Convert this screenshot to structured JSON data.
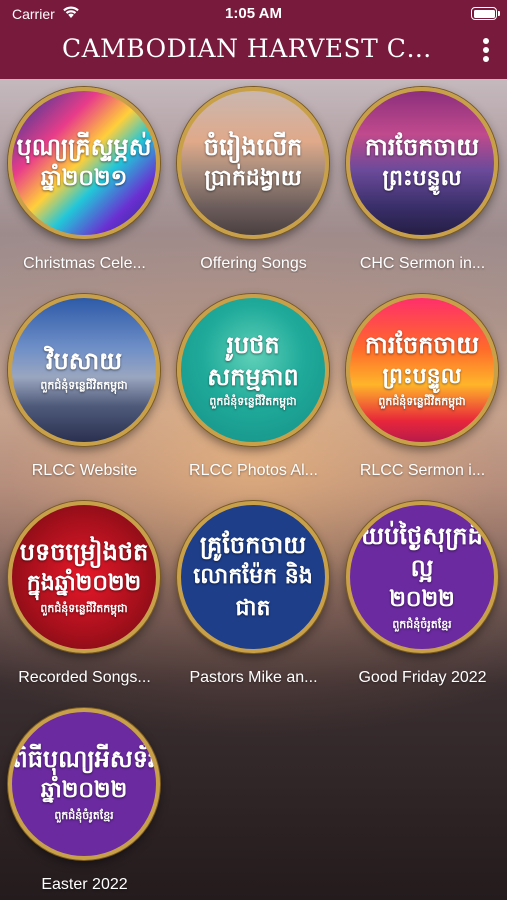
{
  "status_bar": {
    "carrier": "Carrier",
    "time": "1:05 AM"
  },
  "header": {
    "title": "CAMBODIAN HARVEST CH..."
  },
  "tiles": [
    {
      "label": "Christmas Cele...",
      "art_line1": "បុណ្យគ្រីស្ទម្ភស់",
      "art_line2": "ឆ្នាំ២០២១",
      "art_line3": ""
    },
    {
      "label": "Offering Songs",
      "art_line1": "ចំរៀងលើក",
      "art_line2": "ប្រាក់ដង្វាយ",
      "art_line3": ""
    },
    {
      "label": "CHC Sermon in...",
      "art_line1": "ការចែកចាយ",
      "art_line2": "ព្រះបន្ទូល",
      "art_line3": ""
    },
    {
      "label": "RLCC Website",
      "art_line1": "វិបសាយ",
      "art_line2": "",
      "art_line3": "ពួកជំនុំទន្លេជីវិតកម្ពុជា"
    },
    {
      "label": "RLCC Photos Al...",
      "art_line1": "រូបថតសកម្មភាព",
      "art_line2": "",
      "art_line3": "ពួកជំនុំទន្លេជីវិតកម្ពុជា"
    },
    {
      "label": "RLCC Sermon i...",
      "art_line1": "ការចែកចាយ",
      "art_line2": "ព្រះបន្ទូល",
      "art_line3": "ពួកជំនុំទន្លេជីវិតកម្ពុជា"
    },
    {
      "label": "Recorded Songs...",
      "art_line1": "បទចម្រៀងថត",
      "art_line2": "ក្នុងឆ្នាំ២០២២",
      "art_line3": "ពួកជំនុំទន្លេជីវិតកម្ពុជា"
    },
    {
      "label": "Pastors Mike an...",
      "art_line1": "គ្រូចែកចាយ",
      "art_line2": "លោកម៉ែក និង ជាត",
      "art_line3": ""
    },
    {
      "label": "Good Friday 2022",
      "art_line1": "យប់ថ្ងៃសុក្រដ៏ល្អ",
      "art_line2": "២០២២",
      "art_line3": "ពួកជំនុំចំរូតខ្មែរ"
    },
    {
      "label": "Easter 2022",
      "art_line1": "ពិធីបុណ្យអីសទ័រ",
      "art_line2": "ឆ្នាំ២០២២",
      "art_line3": "ពួកជំនុំចំរូតខ្មែរ"
    }
  ]
}
